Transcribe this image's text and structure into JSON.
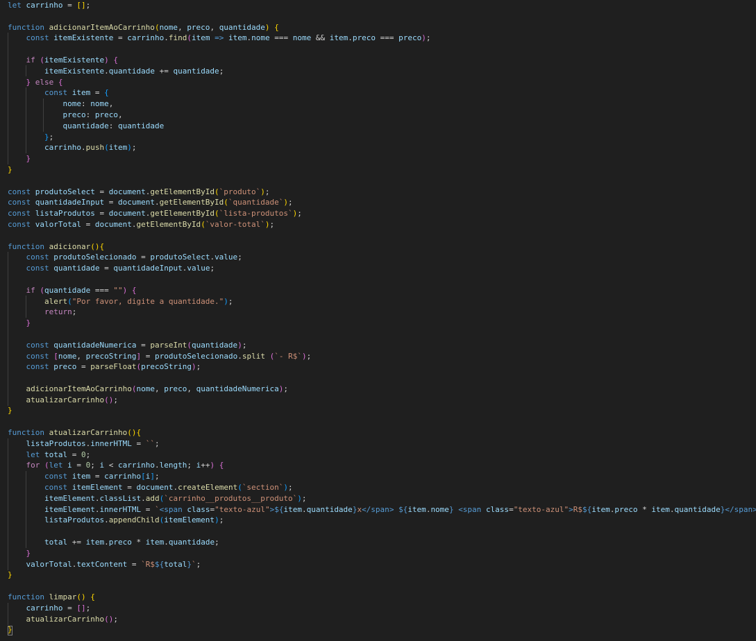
{
  "editor": {
    "language": "javascript",
    "theme": {
      "background": "#1f1f1f",
      "keyword": "#569cd6",
      "control": "#c586c0",
      "function": "#dcdcaa",
      "variable": "#9cdcfe",
      "constant": "#4fc1ff",
      "string": "#ce9178",
      "number": "#b5cea8",
      "bracket1": "#ffd700",
      "bracket2": "#da70d6",
      "bracket3": "#179fff"
    },
    "lines": [
      "let carrinho = [];",
      "",
      "function adicionarItemAoCarrinho(nome, preco, quantidade) {",
      "    const itemExistente = carrinho.find(item => item.nome === nome && item.preco === preco);",
      "",
      "    if (itemExistente) {",
      "        itemExistente.quantidade += quantidade;",
      "    } else {",
      "        const item = {",
      "            nome: nome,",
      "            preco: preco,",
      "            quantidade: quantidade",
      "        };",
      "        carrinho.push(item);",
      "    }",
      "}",
      "",
      "const produtoSelect = document.getElementById(`produto`);",
      "const quantidadeInput = document.getElementById(`quantidade`);",
      "const listaProdutos = document.getElementById(`lista-produtos`);",
      "const valorTotal = document.getElementById(`valor-total`);",
      "",
      "function adicionar(){",
      "    const produtoSelecionado = produtoSelect.value;",
      "    const quantidade = quantidadeInput.value;",
      "",
      "    if (quantidade === \"\") {",
      "        alert(\"Por favor, digite a quantidade.\");",
      "        return;",
      "    }",
      "",
      "    const quantidadeNumerica = parseInt(quantidade);",
      "    const [nome, precoString] = produtoSelecionado.split (`- R$`);",
      "    const preco = parseFloat(precoString);",
      "",
      "    adicionarItemAoCarrinho(nome, preco, quantidadeNumerica);",
      "    atualizarCarrinho();",
      "}",
      "",
      "function atualizarCarrinho(){",
      "    listaProdutos.innerHTML = ``;",
      "    let total = 0;",
      "    for (let i = 0; i < carrinho.length; i++) {",
      "        const item = carrinho[i];",
      "        const itemElement = document.createElement(`section`);",
      "        itemElement.classList.add(`carrinho__produtos__produto`);",
      "        itemElement.innerHTML = `<span class=\"texto-azul\">${item.quantidade}x</span> ${item.nome} <span class=\"texto-azul\">R$${item.preco * item.quantidade}</span>`;",
      "        listaProdutos.appendChild(itemElement);",
      "",
      "        total += item.preco * item.quantidade;",
      "    }",
      "    valorTotal.textContent = `R$${total}`;",
      "}",
      "",
      "function limpar() {",
      "    carrinho = [];",
      "    atualizarCarrinho();",
      "}"
    ]
  }
}
